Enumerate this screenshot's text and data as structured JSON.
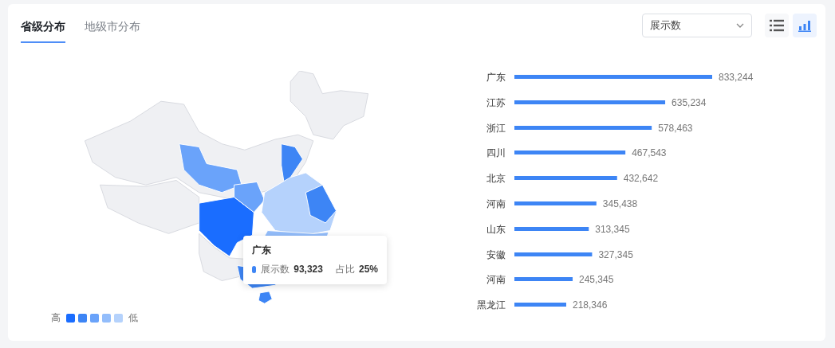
{
  "tabs": [
    {
      "label": "省级分布",
      "selected": true
    },
    {
      "label": "地级市分布",
      "selected": false
    }
  ],
  "metric_select": {
    "value": "展示数"
  },
  "view_buttons": [
    {
      "kind": "list",
      "selected": false
    },
    {
      "kind": "bar",
      "selected": true
    }
  ],
  "map": {
    "legend": {
      "high": "高",
      "low": "低",
      "swatches": [
        {
          "color": "#1a6dff"
        },
        {
          "color": "#3d85f5"
        },
        {
          "color": "#6aa3fa"
        },
        {
          "color": "#93bdfb"
        },
        {
          "color": "#b5d2fc"
        }
      ]
    },
    "tooltip": {
      "title": "广东",
      "color": "#3d85f5",
      "series_label": "展示数",
      "value": "93,323",
      "share_label": "占比",
      "share": "25%"
    }
  },
  "chart_data": {
    "type": "bar",
    "orientation": "horizontal",
    "data_labels": true,
    "categories": [
      "广东",
      "江苏",
      "浙江",
      "四川",
      "北京",
      "河南",
      "山东",
      "安徽",
      "河南",
      "黑龙江"
    ],
    "series": [
      {
        "color": "#3d85f5",
        "values": [
          833244,
          635234,
          578463,
          467543,
          432642,
          345438,
          313345,
          327345,
          245345,
          218346
        ],
        "value_labels": [
          "833,244",
          "635,234",
          "578,463",
          "467,543",
          "432,642",
          "345,438",
          "313,345",
          "327,345",
          "245,345",
          "218,346"
        ]
      }
    ]
  }
}
